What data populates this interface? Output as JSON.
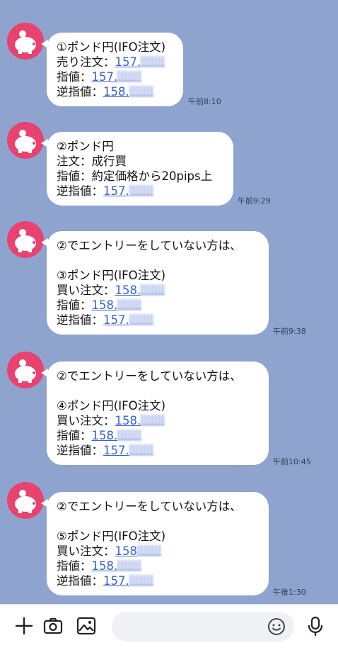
{
  "messages": [
    {
      "lines": [
        "①ポンド円(IFO注文)",
        "売り注文：",
        "指値：",
        "逆指値："
      ],
      "prices": [
        "157.",
        "157.",
        "158."
      ],
      "time": "午前8:10"
    },
    {
      "lines": [
        "②ポンド円",
        "注文：成行買",
        "指値：約定価格から20pips上",
        "逆指値："
      ],
      "prices": [
        "157."
      ],
      "time": "午前9:29"
    },
    {
      "lines": [
        "②でエントリーをしていない方は、",
        "",
        "③ポンド円(IFO注文)",
        "買い注文：",
        "指値：",
        "逆指値："
      ],
      "prices": [
        "158.",
        "158.",
        "157."
      ],
      "time": "午前9:38"
    },
    {
      "lines": [
        "②でエントリーをしていない方は、",
        "",
        "④ポンド円(IFO注文)",
        "買い注文：",
        "指値：",
        "逆指値："
      ],
      "prices": [
        "158.",
        "158.",
        "157."
      ],
      "time": "午前10:45"
    },
    {
      "lines": [
        "②でエントリーをしていない方は、",
        "",
        "⑤ポンド円(IFO注文)",
        "買い注文：",
        "指値：",
        "逆指値："
      ],
      "prices": [
        "158",
        "158.",
        "157."
      ],
      "time": "午後1:30"
    }
  ],
  "toolbar": {
    "icons": [
      "plus-icon",
      "camera-icon",
      "image-icon",
      "emoji-icon",
      "microphone-icon"
    ]
  }
}
